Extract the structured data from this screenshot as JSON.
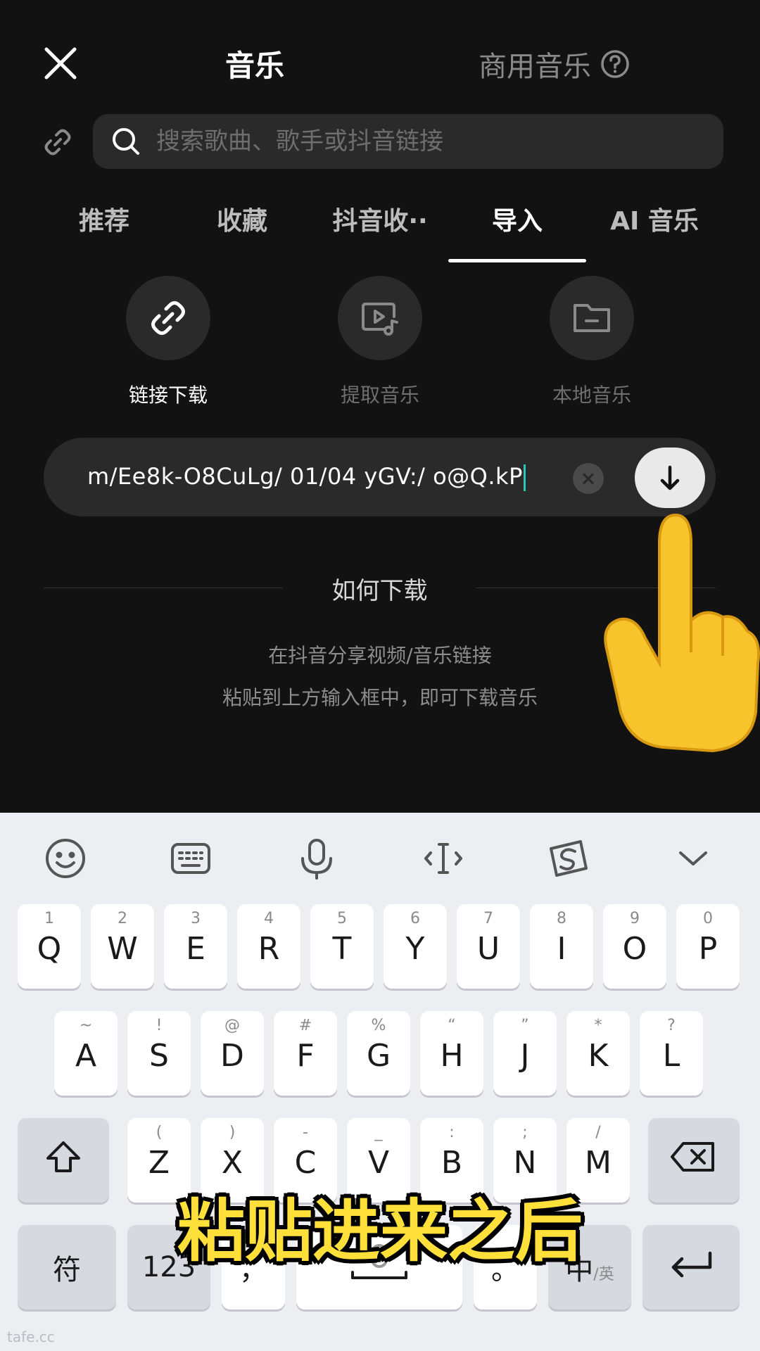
{
  "header": {
    "title": "音乐",
    "commercial_label": "商用音乐"
  },
  "search": {
    "placeholder": "搜索歌曲、歌手或抖音链接"
  },
  "tabs": [
    {
      "label": "推荐"
    },
    {
      "label": "收藏"
    },
    {
      "label": "抖音收··"
    },
    {
      "label": "导入",
      "active": true
    },
    {
      "label": "AI 音乐"
    }
  ],
  "tools": [
    {
      "label": "链接下载",
      "active": true,
      "icon": "link-icon"
    },
    {
      "label": "提取音乐",
      "active": false,
      "icon": "video-music-icon"
    },
    {
      "label": "本地音乐",
      "active": false,
      "icon": "folder-icon"
    }
  ],
  "url_field": {
    "value": "m/Ee8k-O8CuLg/ 01/04 yGV:/ o@Q.kP"
  },
  "help": {
    "title": "如何下载",
    "line1": "在抖音分享视频/音乐链接",
    "line2": "粘贴到上方输入框中，即可下载音乐"
  },
  "keyboard": {
    "row1": [
      {
        "hint": "1",
        "key": "Q"
      },
      {
        "hint": "2",
        "key": "W"
      },
      {
        "hint": "3",
        "key": "E"
      },
      {
        "hint": "4",
        "key": "R"
      },
      {
        "hint": "5",
        "key": "T"
      },
      {
        "hint": "6",
        "key": "Y"
      },
      {
        "hint": "7",
        "key": "U"
      },
      {
        "hint": "8",
        "key": "I"
      },
      {
        "hint": "9",
        "key": "O"
      },
      {
        "hint": "0",
        "key": "P"
      }
    ],
    "row2": [
      {
        "hint": "~",
        "key": "A"
      },
      {
        "hint": "!",
        "key": "S"
      },
      {
        "hint": "@",
        "key": "D"
      },
      {
        "hint": "#",
        "key": "F"
      },
      {
        "hint": "%",
        "key": "G"
      },
      {
        "hint": "“",
        "key": "H"
      },
      {
        "hint": "”",
        "key": "J"
      },
      {
        "hint": "*",
        "key": "K"
      },
      {
        "hint": "?",
        "key": "L"
      }
    ],
    "row3": [
      {
        "hint": "(",
        "key": "Z"
      },
      {
        "hint": ")",
        "key": "X"
      },
      {
        "hint": "-",
        "key": "C"
      },
      {
        "hint": "_",
        "key": "V"
      },
      {
        "hint": ":",
        "key": "B"
      },
      {
        "hint": ";",
        "key": "N"
      },
      {
        "hint": "/",
        "key": "M"
      }
    ],
    "symbols_key": "符",
    "numbers_key": "123",
    "comma_key": "，",
    "period_key": "。",
    "lang_key_main": "中",
    "lang_key_alt": "/英"
  },
  "caption": "粘贴进来之后",
  "watermark": "tafe.cc"
}
